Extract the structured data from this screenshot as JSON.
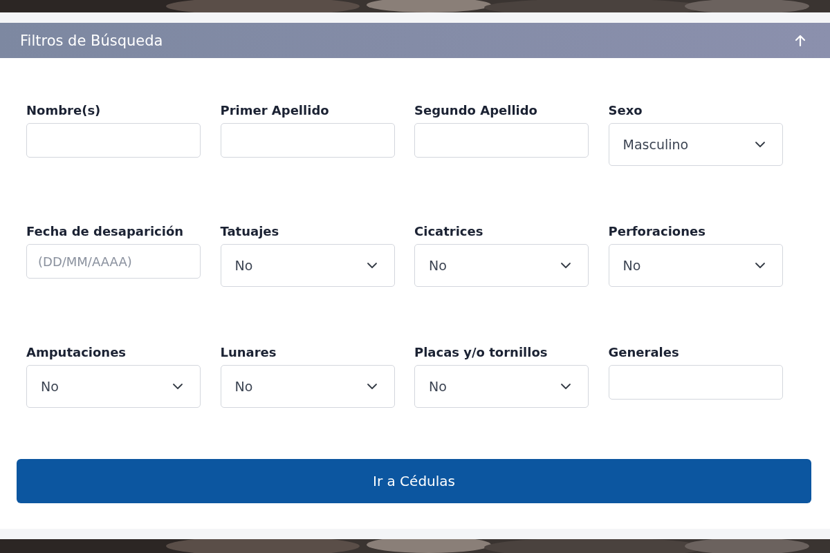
{
  "panel": {
    "title": "Filtros de Búsqueda",
    "expanded": true
  },
  "fields": [
    {
      "label": "Nombre(s)",
      "kind": "text"
    },
    {
      "label": "Primer Apellido",
      "kind": "text"
    },
    {
      "label": "Segundo Apellido",
      "kind": "text"
    },
    {
      "label": "Sexo",
      "kind": "select",
      "value": "Masculino"
    },
    {
      "label": "Fecha de desaparición",
      "kind": "text",
      "placeholder": "(DD/MM/AAAA)"
    },
    {
      "label": "Tatuajes",
      "kind": "select",
      "value": "No"
    },
    {
      "label": "Cicatrices",
      "kind": "select",
      "value": "No"
    },
    {
      "label": "Perforaciones",
      "kind": "select",
      "value": "No"
    },
    {
      "label": "Amputaciones",
      "kind": "select",
      "value": "No"
    },
    {
      "label": "Lunares",
      "kind": "select",
      "value": "No"
    },
    {
      "label": "Placas y/o tornillos",
      "kind": "select",
      "value": "No"
    },
    {
      "label": "Generales",
      "kind": "text"
    }
  ],
  "submit_button": "Ir a Cédulas"
}
